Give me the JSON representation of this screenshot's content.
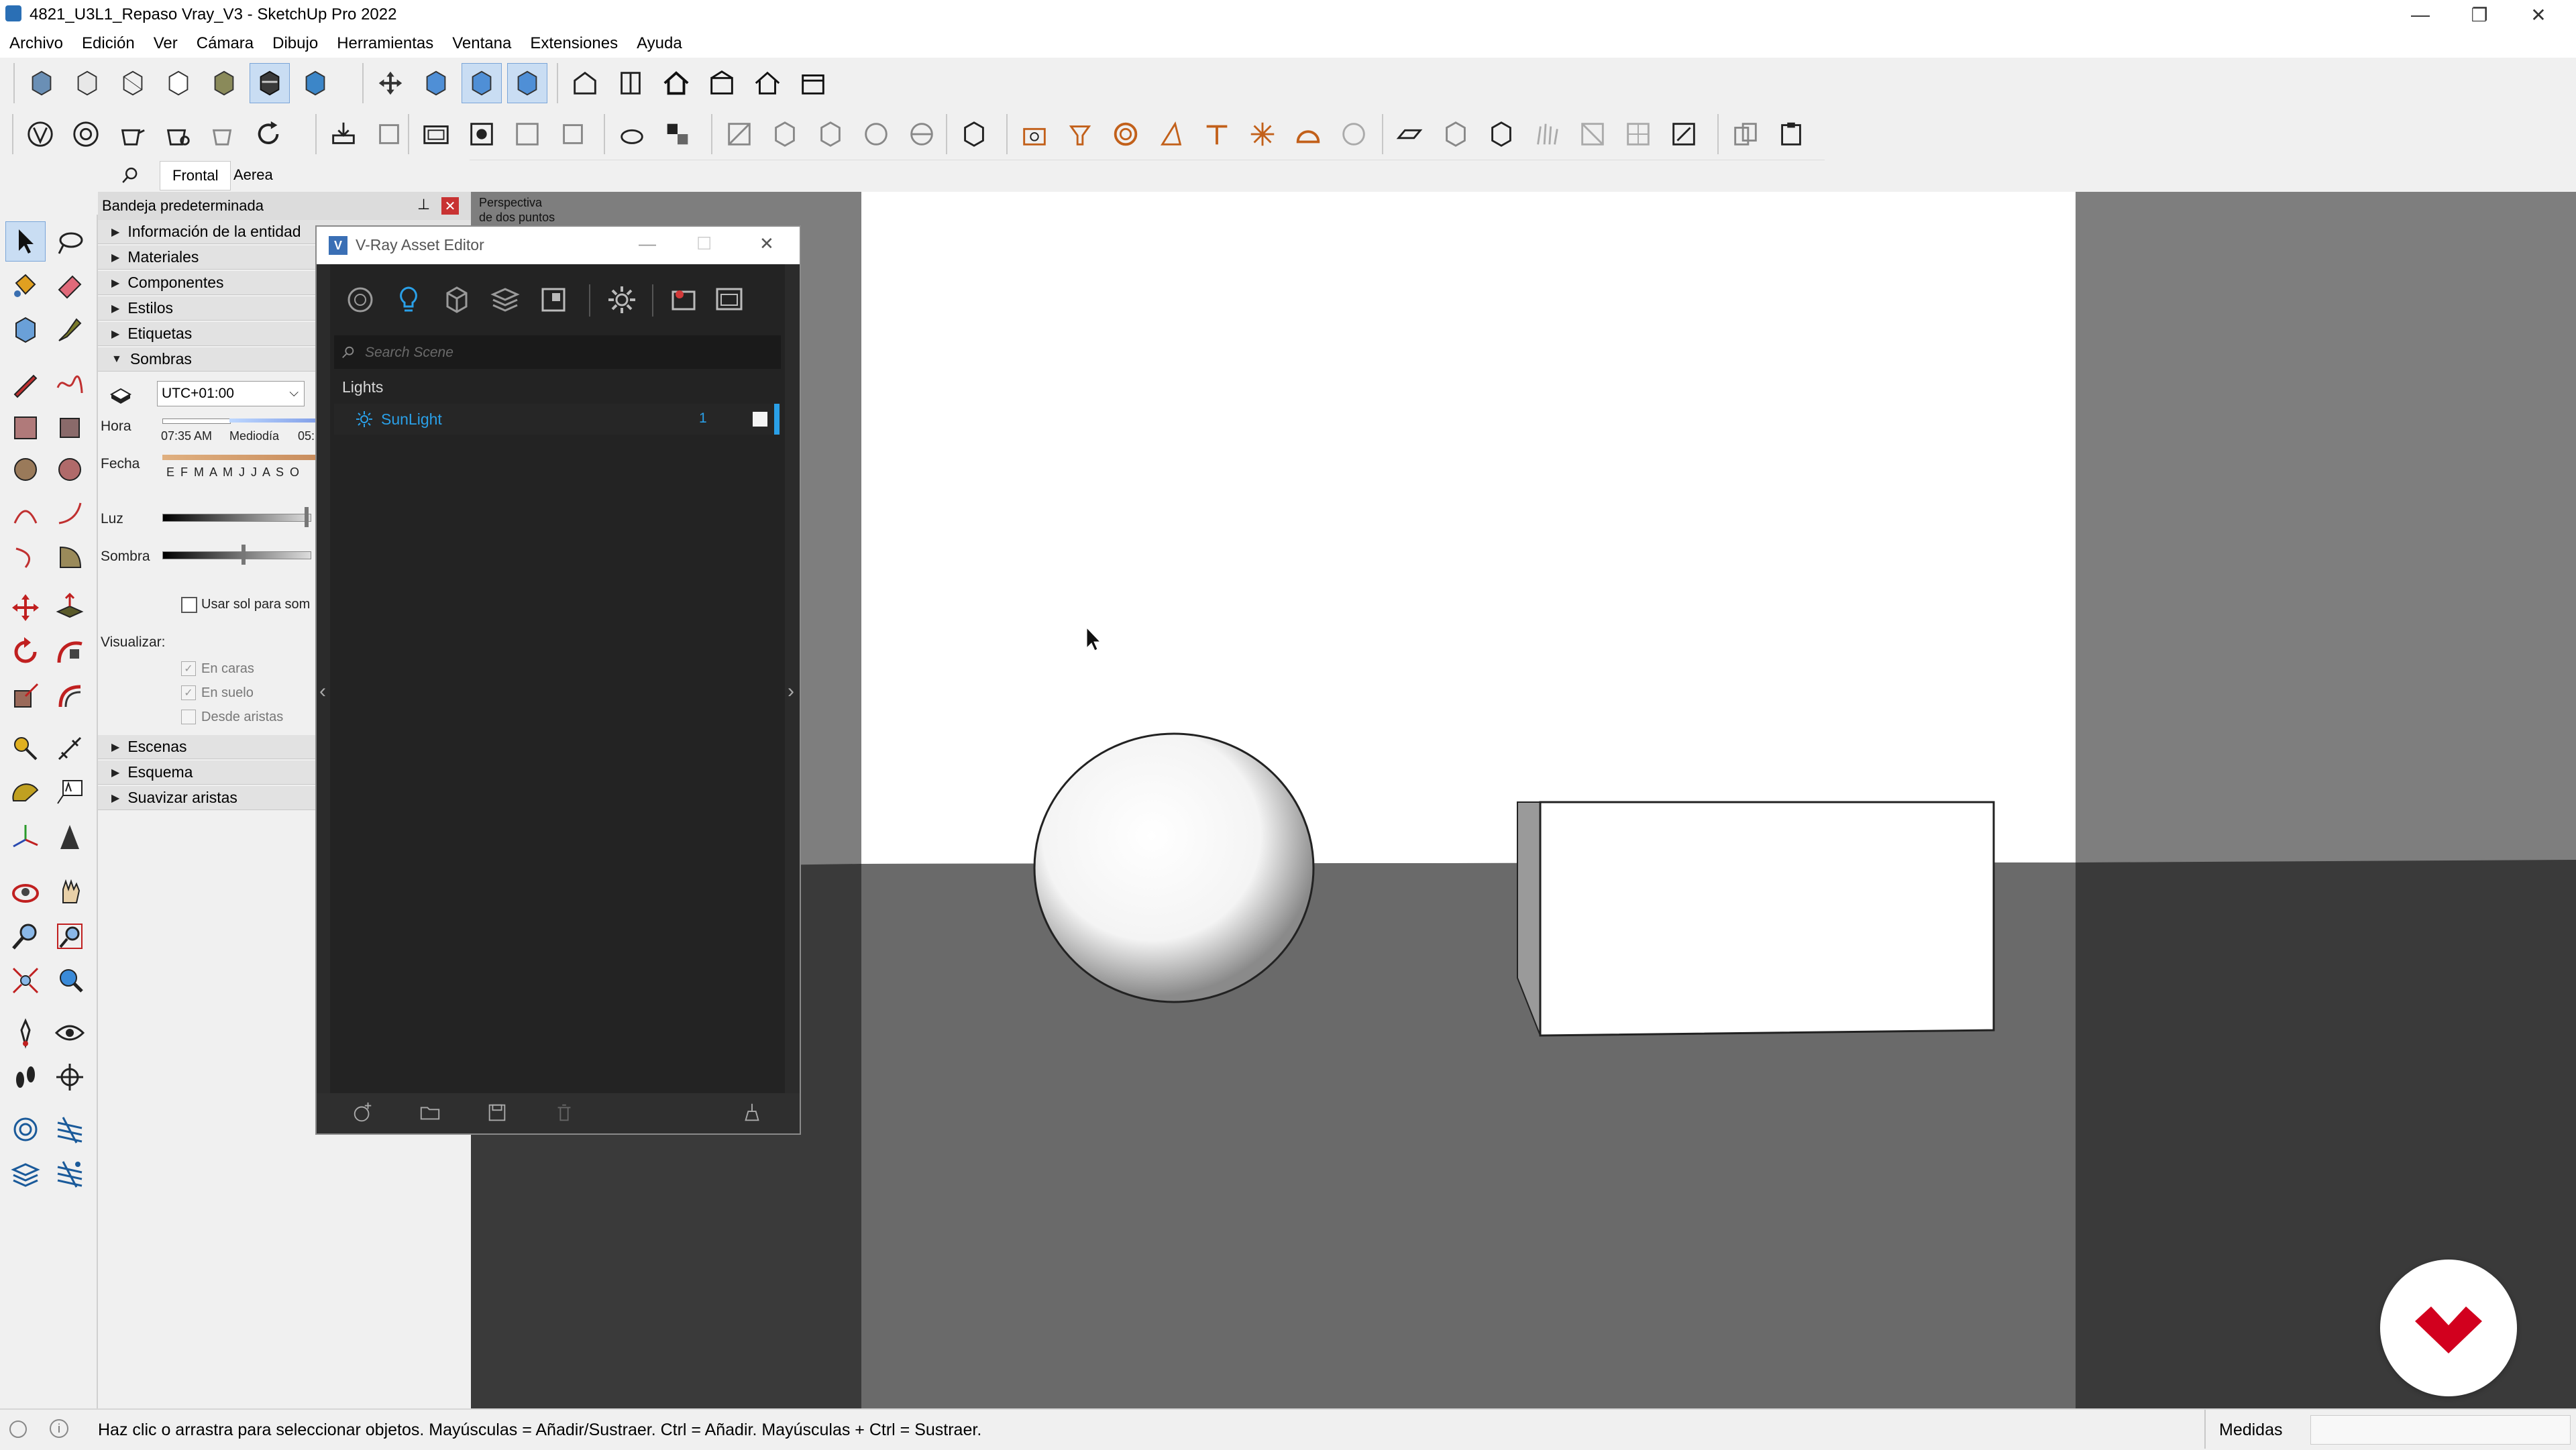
{
  "window": {
    "title": "4821_U3L1_Repaso Vray_V3 - SketchUp Pro 2022",
    "minimize": "—",
    "restore": "❐",
    "close": "✕"
  },
  "menu": [
    "Archivo",
    "Edición",
    "Ver",
    "Cámara",
    "Dibujo",
    "Herramientas",
    "Ventana",
    "Extensiones",
    "Ayuda"
  ],
  "scene_tabs": [
    "Frontal",
    "Aerea"
  ],
  "tray": {
    "title": "Bandeja predeterminada",
    "sections_top": [
      "Información de la entidad",
      "Materiales",
      "Componentes",
      "Estilos",
      "Etiquetas",
      "Sombras"
    ],
    "sections_bottom": [
      "Escenas",
      "Esquema",
      "Suavizar aristas"
    ],
    "shadows": {
      "timezone": "UTC+01:00",
      "hora_label": "Hora",
      "hora_start": "07:35 AM",
      "hora_mid": "Mediodía",
      "hora_end": "05:",
      "fecha_label": "Fecha",
      "months": "E F M A M J J A S O",
      "luz_label": "Luz",
      "sombra_label": "Sombra",
      "use_sun": "Usar sol para som",
      "visualizar_label": "Visualizar:",
      "en_caras": "En caras",
      "en_suelo": "En suelo",
      "desde_aristas": "Desde aristas",
      "luz_level": 0.95,
      "sombra_level": 0.52
    }
  },
  "viewport": {
    "camera_label_1": "Perspectiva",
    "camera_label_2": "de dos puntos"
  },
  "vray": {
    "title": "V-Ray Asset Editor",
    "search_placeholder": "Search Scene",
    "category": "Lights",
    "items": [
      {
        "name": "SunLight",
        "count": "1"
      }
    ]
  },
  "status": {
    "hint": "Haz clic o arrastra para seleccionar objetos. Mayúsculas = Añadir/Sustraer. Ctrl = Añadir. Mayúsculas + Ctrl = Sustraer.",
    "measure_label": "Medidas"
  },
  "colors": {
    "accent": "#2aa0e8",
    "logo_red": "#d2001e"
  }
}
